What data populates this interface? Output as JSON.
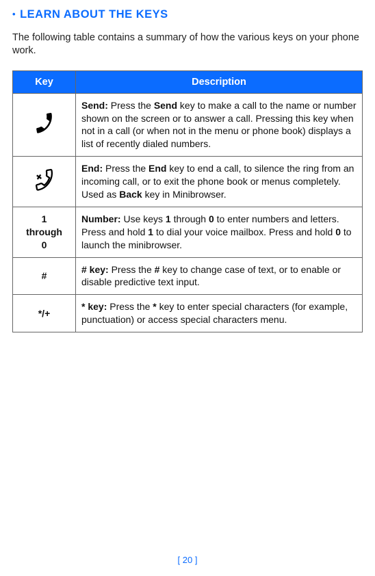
{
  "heading": {
    "bullet": "•",
    "text": "LEARN ABOUT THE KEYS"
  },
  "intro": "The following table contains a summary of how the various keys on your phone work.",
  "table": {
    "headers": {
      "key": "Key",
      "description": "Description"
    },
    "rows": [
      {
        "icon": "phone-send-icon",
        "key_label": "",
        "desc_bold": "Send:",
        "desc_part1": " Press the ",
        "desc_bold2": "Send",
        "desc_part2": " key to make a call to the name or number shown on the screen or to answer a call. Pressing this key when not in a call (or when not in the menu or phone book) displays a list of recently dialed numbers."
      },
      {
        "icon": "phone-end-icon",
        "key_label": "",
        "desc_bold": "End:",
        "desc_part1": " Press the ",
        "desc_bold2": "End",
        "desc_part2": " key to end a call, to silence the ring from an incoming call, or to exit the phone book or menus completely. Used as ",
        "desc_bold3": "Back",
        "desc_part3": " key in Minibrowser."
      },
      {
        "icon": "",
        "key_label_line1": "1",
        "key_label_line2": "through",
        "key_label_line3": "0",
        "desc_bold": "Number:",
        "desc_part1": " Use keys ",
        "desc_bold2": "1",
        "desc_part2": " through ",
        "desc_bold3": "0",
        "desc_part3": " to enter numbers and letters. Press and hold ",
        "desc_bold4": "1",
        "desc_part4": " to dial your voice mailbox. Press and hold ",
        "desc_bold5": "0",
        "desc_part5": " to launch the minibrowser."
      },
      {
        "icon": "",
        "key_label": "#",
        "desc_bold": "# key:",
        "desc_part1": " Press the ",
        "desc_bold2": "#",
        "desc_part2": " key to change case of text, or to enable or disable predictive text input."
      },
      {
        "icon": "",
        "key_label": "*/+",
        "desc_bold": "* key:",
        "desc_part1": " Press the ",
        "desc_bold2": "*",
        "desc_part2": " key to enter special characters (for example, punctuation) or access special characters menu."
      }
    ]
  },
  "page_number": "[ 20 ]"
}
